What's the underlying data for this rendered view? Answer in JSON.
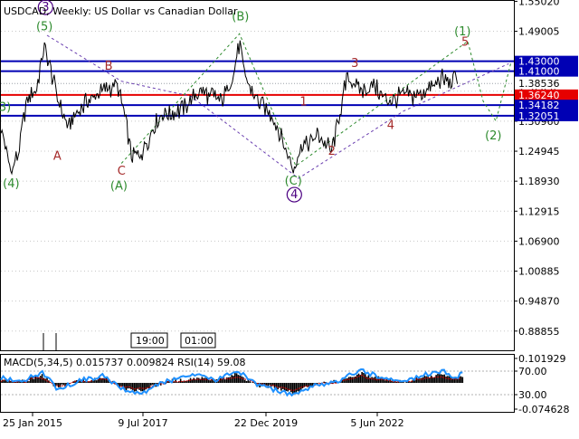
{
  "header": {
    "title": "USDCAD, Weekly:  US Dollar vs Canadian Dollar"
  },
  "colors": {
    "background": "#ffffff",
    "price_line": "#000000",
    "grid": "#c8c8c8",
    "support_resistance": "#0000b4",
    "pivot": "#e60000",
    "price_tag": "#e60000",
    "wave_label_green": "#2e8b2e",
    "wave_label_red": "#a52a2a",
    "wave_label_purple": "#4b0082",
    "dashed_purple": "#6a3fb0",
    "dashed_green": "#2e8b2e",
    "macd_histogram": "#000000",
    "macd_signal": "#cc0000",
    "rsi_line": "#1e90ff"
  },
  "chart_data": [
    {
      "type": "line",
      "title": "USDCAD, Weekly:  US Dollar vs Canadian Dollar",
      "x_ticks": [
        "25 Jan 2015",
        "9 Jul 2017",
        "22 Dec 2019",
        "5 Jun 2022"
      ],
      "time_markers": [
        "19:00",
        "01:00"
      ],
      "ylim": [
        0.85,
        1.551
      ],
      "y_ticks": [
        "1.55020",
        "1.49005",
        "1.42990",
        "1.36975",
        "1.30960",
        "1.24945",
        "1.18930",
        "1.12915",
        "1.06900",
        "1.00885",
        "0.94870",
        "0.88855"
      ],
      "levels": [
        {
          "label": "1.43000",
          "value": 1.43,
          "kind": "resistance"
        },
        {
          "label": "1.41000",
          "value": 1.41,
          "kind": "resistance"
        },
        {
          "label": "1.38536",
          "value": 1.38536,
          "kind": "current"
        },
        {
          "label": "1.36240",
          "value": 1.3624,
          "kind": "pivot"
        },
        {
          "label": "1.34182",
          "value": 1.34182,
          "kind": "support"
        },
        {
          "label": "1.32051",
          "value": 1.32051,
          "kind": "support"
        }
      ],
      "price_path": [
        [
          0.0,
          1.3
        ],
        [
          0.02,
          1.21
        ],
        [
          0.035,
          1.25
        ],
        [
          0.05,
          1.35
        ],
        [
          0.07,
          1.38
        ],
        [
          0.085,
          1.462
        ],
        [
          0.11,
          1.36
        ],
        [
          0.13,
          1.295
        ],
        [
          0.15,
          1.33
        ],
        [
          0.19,
          1.37
        ],
        [
          0.215,
          1.375
        ],
        [
          0.225,
          1.39
        ],
        [
          0.24,
          1.33
        ],
        [
          0.255,
          1.24
        ],
        [
          0.27,
          1.24
        ],
        [
          0.31,
          1.32
        ],
        [
          0.35,
          1.33
        ],
        [
          0.39,
          1.37
        ],
        [
          0.43,
          1.35
        ],
        [
          0.455,
          1.41
        ],
        [
          0.465,
          1.466
        ],
        [
          0.475,
          1.4
        ],
        [
          0.5,
          1.35
        ],
        [
          0.53,
          1.32
        ],
        [
          0.56,
          1.24
        ],
        [
          0.57,
          1.212
        ],
        [
          0.585,
          1.26
        ],
        [
          0.62,
          1.28
        ],
        [
          0.645,
          1.25
        ],
        [
          0.66,
          1.32
        ],
        [
          0.675,
          1.4
        ],
        [
          0.7,
          1.37
        ],
        [
          0.73,
          1.38
        ],
        [
          0.75,
          1.35
        ],
        [
          0.78,
          1.36
        ],
        [
          0.81,
          1.36
        ],
        [
          0.84,
          1.38
        ],
        [
          0.86,
          1.397
        ],
        [
          0.875,
          1.38
        ],
        [
          0.89,
          1.4
        ]
      ],
      "wave_labels": [
        {
          "text": "(5)",
          "x": 0.085,
          "y": 1.492,
          "color": "green"
        },
        {
          "text": "3",
          "x": 0.087,
          "y": 1.531,
          "color": "purple",
          "circled": true
        },
        {
          "text": "3)",
          "x": 0.008,
          "y": 1.33,
          "color": "green"
        },
        {
          "text": "(4)",
          "x": 0.02,
          "y": 1.177,
          "color": "green"
        },
        {
          "text": "A",
          "x": 0.11,
          "y": 1.232,
          "color": "red"
        },
        {
          "text": "B",
          "x": 0.21,
          "y": 1.413,
          "color": "red"
        },
        {
          "text": "C",
          "x": 0.235,
          "y": 1.202,
          "color": "red"
        },
        {
          "text": "(A)",
          "x": 0.23,
          "y": 1.172,
          "color": "green"
        },
        {
          "text": "(B)",
          "x": 0.467,
          "y": 1.512,
          "color": "green"
        },
        {
          "text": "1",
          "x": 0.59,
          "y": 1.341,
          "color": "red"
        },
        {
          "text": "(C)",
          "x": 0.57,
          "y": 1.182,
          "color": "green"
        },
        {
          "text": "4",
          "x": 0.572,
          "y": 1.155,
          "color": "purple",
          "circled": true
        },
        {
          "text": "2",
          "x": 0.645,
          "y": 1.242,
          "color": "red"
        },
        {
          "text": "3",
          "x": 0.69,
          "y": 1.418,
          "color": "red"
        },
        {
          "text": "4",
          "x": 0.76,
          "y": 1.294,
          "color": "red"
        },
        {
          "text": "5",
          "x": 0.905,
          "y": 1.461,
          "color": "red"
        },
        {
          "text": "(1)",
          "x": 0.9,
          "y": 1.482,
          "color": "green"
        },
        {
          "text": "(2)",
          "x": 0.96,
          "y": 1.273,
          "color": "green"
        }
      ],
      "purple_dashed_path": [
        [
          0.09,
          1.482
        ],
        [
          0.235,
          1.39
        ],
        [
          0.37,
          1.36
        ],
        [
          0.58,
          1.195
        ],
        [
          0.785,
          1.33
        ],
        [
          0.99,
          1.425
        ]
      ],
      "green_dashed_path": [
        [
          0.235,
          1.225
        ],
        [
          0.465,
          1.485
        ],
        [
          0.575,
          1.22
        ],
        [
          0.91,
          1.47
        ],
        [
          0.94,
          1.35
        ],
        [
          0.965,
          1.31
        ],
        [
          0.995,
          1.43
        ]
      ]
    },
    {
      "type": "line",
      "title": "MACD(5,34,5) 0.015737 0.009824 RSI(14) 59.08",
      "indicators": {
        "macd_main": 0.015737,
        "macd_signal": 0.009824,
        "rsi": 59.08
      },
      "ylim": [
        -0.074628,
        0.101929
      ],
      "y_ticks": [
        "0.101929",
        "70.00",
        "30.00",
        "-0.074628"
      ],
      "rsi_path": [
        [
          0.0,
          58
        ],
        [
          0.04,
          52
        ],
        [
          0.08,
          68
        ],
        [
          0.11,
          40
        ],
        [
          0.16,
          55
        ],
        [
          0.2,
          62
        ],
        [
          0.24,
          38
        ],
        [
          0.27,
          30
        ],
        [
          0.32,
          52
        ],
        [
          0.38,
          63
        ],
        [
          0.42,
          55
        ],
        [
          0.46,
          72
        ],
        [
          0.5,
          45
        ],
        [
          0.55,
          35
        ],
        [
          0.57,
          28
        ],
        [
          0.6,
          42
        ],
        [
          0.66,
          55
        ],
        [
          0.7,
          72
        ],
        [
          0.74,
          60
        ],
        [
          0.78,
          52
        ],
        [
          0.82,
          62
        ],
        [
          0.86,
          70
        ],
        [
          0.89,
          58
        ],
        [
          0.9,
          68
        ]
      ]
    }
  ]
}
